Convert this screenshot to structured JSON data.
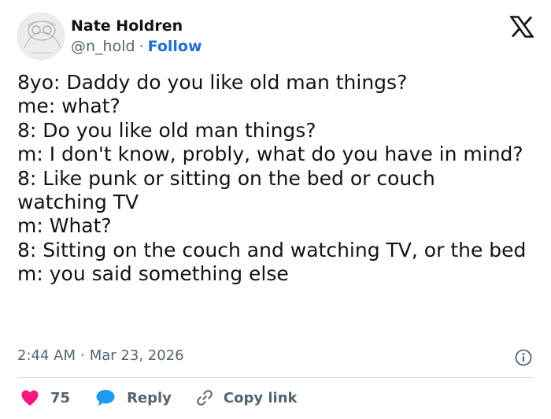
{
  "author": {
    "name": "Nate Holdren",
    "handle": "@n_hold",
    "separator": "·",
    "follow_label": "Follow"
  },
  "tweet": {
    "lines": [
      "8yo: Daddy do you like old man things?",
      "me: what?",
      "8: Do you like old man things?",
      "m: I don't know, probly, what do you have in mind?",
      "8: Like punk or sitting on the bed or couch watching TV",
      "m: What?",
      "8: Sitting on the couch and watching TV, or the bed",
      "m: you said something else"
    ],
    "time": "2:44 AM",
    "date_separator": "·",
    "date": "Mar 23, 2026"
  },
  "actions": {
    "like_count": "75",
    "reply_label": "Reply",
    "copy_link_label": "Copy link"
  },
  "icons": {
    "logo": "x-logo-icon",
    "info": "info-icon",
    "like": "heart-icon",
    "reply": "speech-bubble-icon",
    "copy": "link-icon"
  },
  "colors": {
    "text": "#0f1419",
    "secondary": "#536471",
    "follow": "#1d6fd1",
    "heart": "#f91880",
    "reply_bubble": "#1d9bf0",
    "divider": "#cfd9de"
  }
}
